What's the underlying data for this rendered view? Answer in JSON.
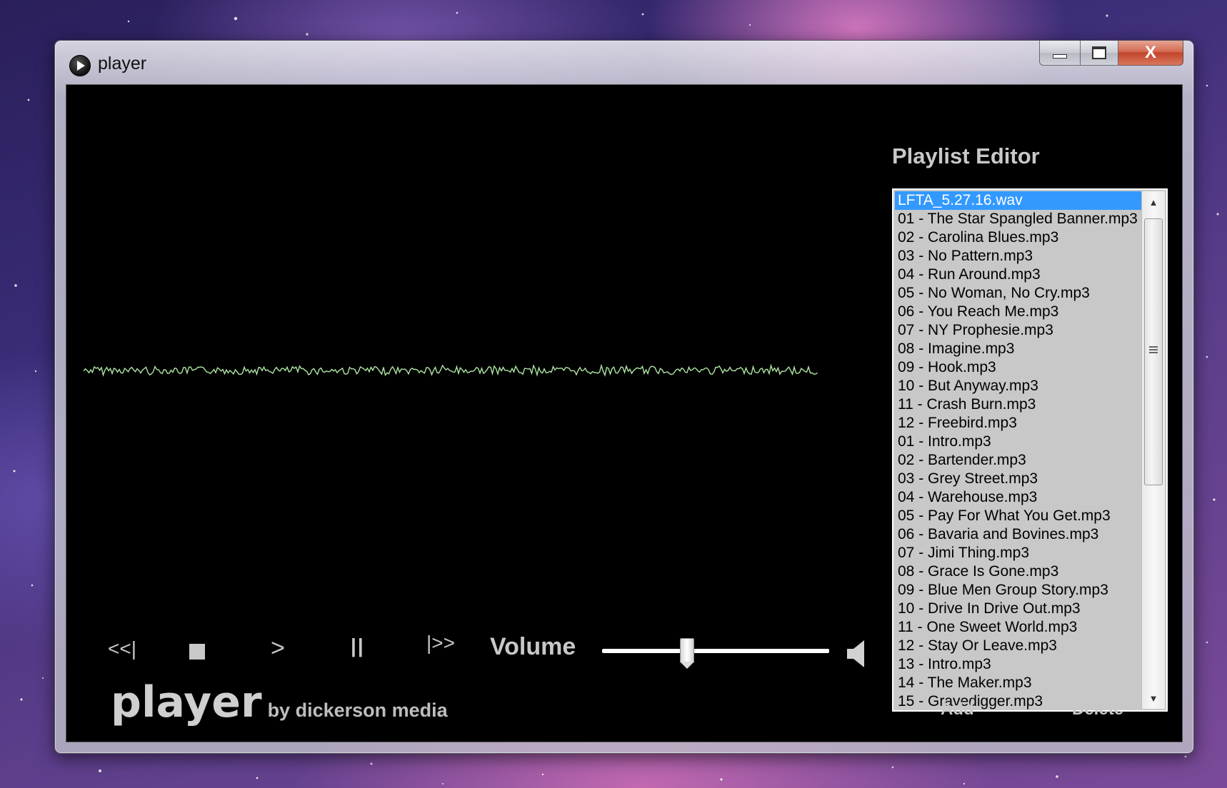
{
  "window": {
    "title": "player",
    "caption_buttons": [
      "minimize",
      "maximize",
      "close"
    ],
    "close_glyph": "X"
  },
  "waveform": {
    "color": "#aee6a4"
  },
  "playlist": {
    "title": "Playlist Editor",
    "selected_index": 0,
    "items": [
      "LFTA_5.27.16.wav",
      "01 - The Star Spangled Banner.mp3",
      "02 - Carolina Blues.mp3",
      "03 - No Pattern.mp3",
      "04 - Run Around.mp3",
      "05 - No Woman, No Cry.mp3",
      "06 - You Reach Me.mp3",
      "07 - NY Prophesie.mp3",
      "08 - Imagine.mp3",
      "09 - Hook.mp3",
      "10 - But Anyway.mp3",
      "11 - Crash Burn.mp3",
      "12 - Freebird.mp3",
      "01 - Intro.mp3",
      "02 - Bartender.mp3",
      "03 - Grey Street.mp3",
      "04 - Warehouse.mp3",
      "05 - Pay For What You Get.mp3",
      "06 - Bavaria and Bovines.mp3",
      "07 - Jimi Thing.mp3",
      "08 - Grace Is Gone.mp3",
      "09 - Blue Men Group Story.mp3",
      "10 - Drive In Drive Out.mp3",
      "11 - One Sweet World.mp3",
      "12 - Stay Or Leave.mp3",
      "13 - Intro.mp3",
      "14 - The Maker.mp3",
      "15 - Gravedigger.mp3"
    ],
    "add_label": "Add",
    "delete_label": "Delete"
  },
  "controls": {
    "prev_label": "<<|",
    "stop_icon": "stop-icon",
    "play_label": ">",
    "pause_label": "||",
    "next_label": "|>>",
    "volume_label": "Volume",
    "volume_level": 0.37
  },
  "brand": {
    "name": "player",
    "subtitle": "by dickerson media"
  },
  "colors": {
    "text": "#c8c8c8",
    "list_background": "#c8c8c8",
    "selection": "#3399ff",
    "client_background": "#000000"
  }
}
